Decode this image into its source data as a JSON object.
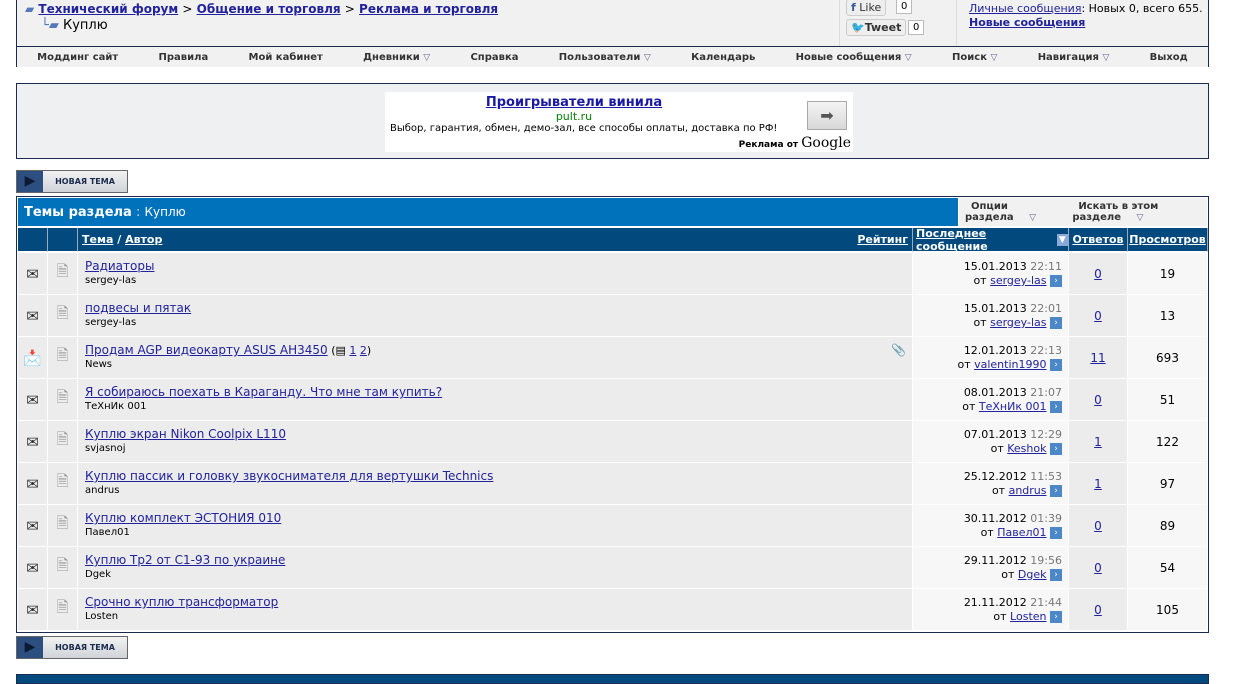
{
  "breadcrumb": {
    "items": [
      "Технический форум",
      "Общение и торговля",
      "Реклама и торговля"
    ],
    "sep": ">",
    "current": "Куплю"
  },
  "social": {
    "like": "Like",
    "like_count": "0",
    "tweet": "Tweet",
    "tweet_count": "0"
  },
  "user": {
    "pm_link": "Личные сообщения",
    "pm_text": ": Новых 0, всего 655.",
    "new_posts": "Новые сообщения"
  },
  "nav": [
    "Моддинг сайт",
    "Правила",
    "Мой кабинет",
    "Дневники",
    "Справка",
    "Пользователи",
    "Календарь",
    "Новые сообщения",
    "Поиск",
    "Навигация",
    "Выход"
  ],
  "nav_dropdown": [
    false,
    false,
    false,
    true,
    false,
    true,
    false,
    true,
    true,
    true,
    false
  ],
  "ad": {
    "title": "Проигрыватели винила",
    "url": "pult.ru",
    "desc": "Выбор, гарантия, обмен, демо-зал, все способы оплаты, доставка по РФ!",
    "by": "Реклама от",
    "google": "Google"
  },
  "new_topic": "НОВАЯ ТЕМА",
  "section": {
    "label": "Темы раздела",
    "sep": " : ",
    "name": "Куплю",
    "options": "Опции раздела",
    "search": "Искать в этом разделе"
  },
  "columns": {
    "topic": "Тема",
    "slash": " / ",
    "author": "Автор",
    "rating": "Рейтинг",
    "last": "Последнее сообщение",
    "replies": "Ответов",
    "views": "Просмотров"
  },
  "from": "от",
  "threads": [
    {
      "title": "Радиаторы",
      "author": "sergey-las",
      "date": "15.01.2013",
      "time": "22:11",
      "last_by": "sergey-las",
      "replies": "0",
      "views": "19"
    },
    {
      "title": "подвесы и пятак",
      "author": "sergey-las",
      "date": "15.01.2013",
      "time": "22:01",
      "last_by": "sergey-las",
      "replies": "0",
      "views": "13"
    },
    {
      "title": "Продам AGP видеокарту ASUS AH3450",
      "author": "News",
      "date": "12.01.2013",
      "time": "22:13",
      "last_by": "valentin1990",
      "replies": "11",
      "views": "693",
      "pages": [
        "1",
        "2"
      ],
      "hot": true,
      "attach": true
    },
    {
      "title": "Я собираюсь поехать в Караганду. Что мне там купить?",
      "author": "ТеХнИк 001",
      "date": "08.01.2013",
      "time": "21:07",
      "last_by": "ТеХнИк 001",
      "replies": "0",
      "views": "51"
    },
    {
      "title": "Куплю экран Nikon Coolpix L110",
      "author": "svjasnoj",
      "date": "07.01.2013",
      "time": "12:29",
      "last_by": "Keshok",
      "replies": "1",
      "views": "122"
    },
    {
      "title": "Куплю пассик и головку звукоснимателя для вертушки Technics",
      "author": "andrus",
      "date": "25.12.2012",
      "time": "11:53",
      "last_by": "andrus",
      "replies": "1",
      "views": "97"
    },
    {
      "title": "Куплю комплект ЭСТОНИЯ 010",
      "author": "Павел01",
      "date": "30.11.2012",
      "time": "01:39",
      "last_by": "Павел01",
      "replies": "0",
      "views": "89"
    },
    {
      "title": "Куплю Тр2 от С1-93 по украине",
      "author": "Dgek",
      "date": "29.11.2012",
      "time": "19:56",
      "last_by": "Dgek",
      "replies": "0",
      "views": "54"
    },
    {
      "title": "Срочно куплю трансформатор",
      "author": "Losten",
      "date": "21.11.2012",
      "time": "21:44",
      "last_by": "Losten",
      "replies": "0",
      "views": "105"
    }
  ]
}
